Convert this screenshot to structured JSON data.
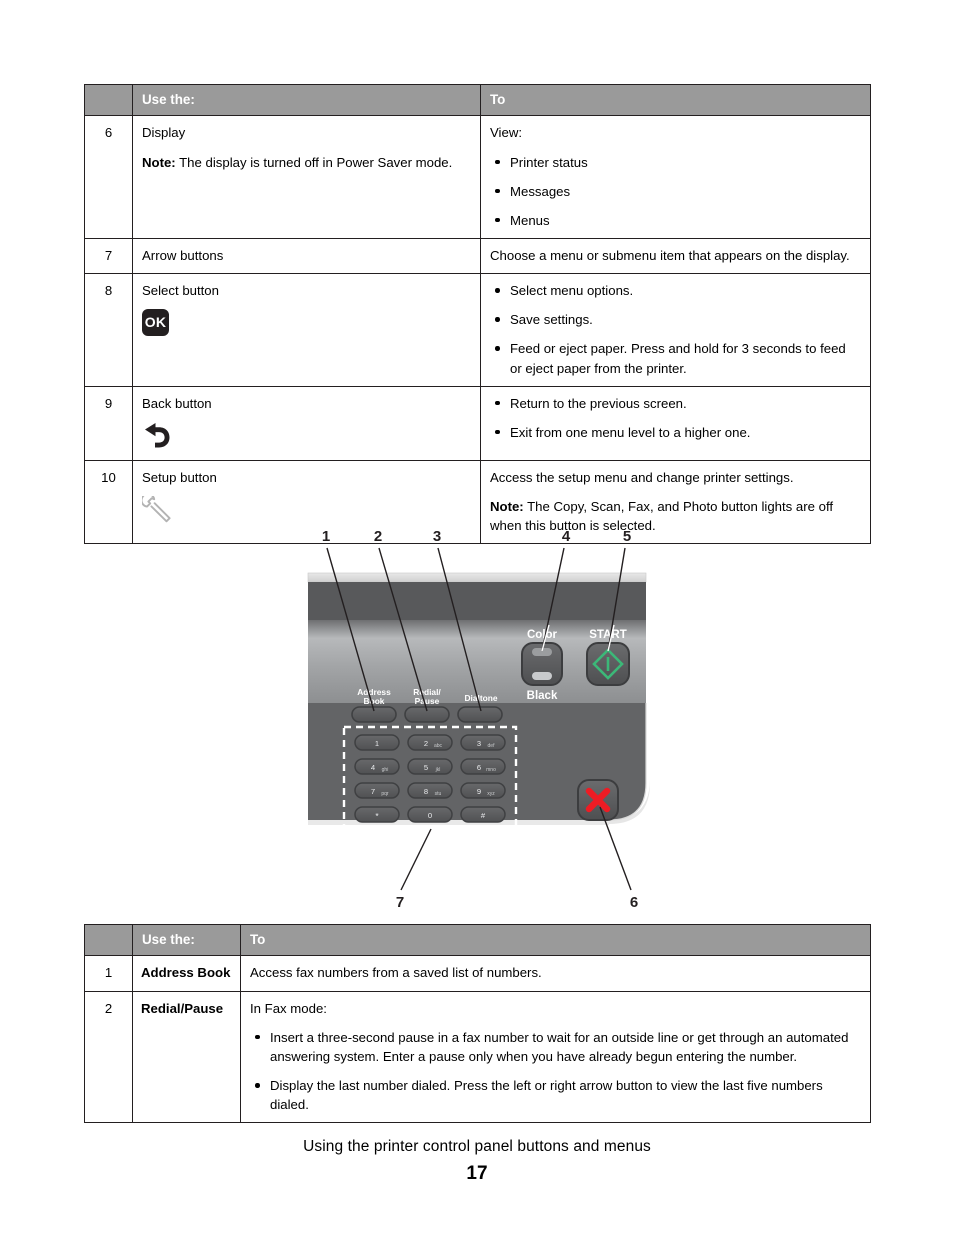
{
  "tables": {
    "top": {
      "headers": [
        "",
        "Use the:",
        "To"
      ],
      "rows": [
        {
          "num": "6",
          "use_the_lines": [
            "Display"
          ],
          "use_the_note_label": "Note:",
          "use_the_note_text": " The display is turned off in Power Saver mode.",
          "to_intro": "View:",
          "to_bullets": [
            "Printer status",
            "Messages",
            "Menus"
          ],
          "icon": ""
        },
        {
          "num": "7",
          "use_the_lines": [
            "Arrow buttons"
          ],
          "to_paragraph": "Choose a menu or submenu item that appears on the display."
        },
        {
          "num": "8",
          "use_the_lines": [
            "Select button"
          ],
          "icon": "ok-button-icon",
          "icon_label": "OK",
          "to_bullets": [
            "Select menu options.",
            "Save settings.",
            "Feed or eject paper. Press and hold for 3 seconds to feed or eject paper from the printer."
          ]
        },
        {
          "num": "9",
          "use_the_lines": [
            "Back button"
          ],
          "icon": "back-arrow-icon",
          "to_bullets": [
            "Return to the previous screen.",
            "Exit from one menu level to a higher one."
          ]
        },
        {
          "num": "10",
          "use_the_lines": [
            "Setup button"
          ],
          "icon": "wrench-icon",
          "to_paragraph": "Access the setup menu and change printer settings.",
          "to_note_label": "Note:",
          "to_note_text": " The Copy, Scan, Fax, and Photo button lights are off when this button is selected."
        }
      ]
    },
    "bottom": {
      "headers": [
        "",
        "Use the:",
        "To"
      ],
      "rows": [
        {
          "num": "1",
          "label": "Address Book",
          "to_paragraph": "Access fax numbers from a saved list of numbers."
        },
        {
          "num": "2",
          "label": "Redial/Pause",
          "to_intro": "In Fax mode:",
          "to_bullets": [
            "Insert a three-second pause in a fax number to wait for an outside line or get through an automated answering system. Enter a pause only when you have already begun entering the number.",
            "Display the last number dialed. Press the left or right arrow button to view the last five numbers dialed."
          ]
        }
      ]
    }
  },
  "diagram": {
    "callouts_top": [
      "1",
      "2",
      "3",
      "4",
      "5"
    ],
    "callouts_bottom": [
      "7",
      "6"
    ],
    "panel_labels": {
      "address_book": [
        "Address",
        "Book"
      ],
      "redial_pause": [
        "Redial/",
        "Pause"
      ],
      "dialtone": "Dialtone",
      "color": "Color",
      "black": "Black",
      "start": "START"
    },
    "keypad": [
      [
        {
          "digit": "1",
          "letters": ""
        },
        {
          "digit": "2",
          "letters": "abc"
        },
        {
          "digit": "3",
          "letters": "def"
        }
      ],
      [
        {
          "digit": "4",
          "letters": "ghi"
        },
        {
          "digit": "5",
          "letters": "jkl"
        },
        {
          "digit": "6",
          "letters": "mno"
        }
      ],
      [
        {
          "digit": "7",
          "letters": "pqr"
        },
        {
          "digit": "8",
          "letters": "stu"
        },
        {
          "digit": "9",
          "letters": "xyz"
        }
      ],
      [
        {
          "digit": "*",
          "letters": ""
        },
        {
          "digit": "0",
          "letters": ""
        },
        {
          "digit": "#",
          "letters": ""
        }
      ]
    ],
    "colors": {
      "panel_dark": "#58595b",
      "panel_mid": "#6d6e70",
      "panel_light": "#a7a9ab",
      "start_green": "#3cb878",
      "cancel_red": "#ed1c24",
      "key_fill": "#5c5d5f"
    }
  },
  "footer": {
    "title": "Using the printer control panel buttons and menus",
    "page_number": "17"
  }
}
